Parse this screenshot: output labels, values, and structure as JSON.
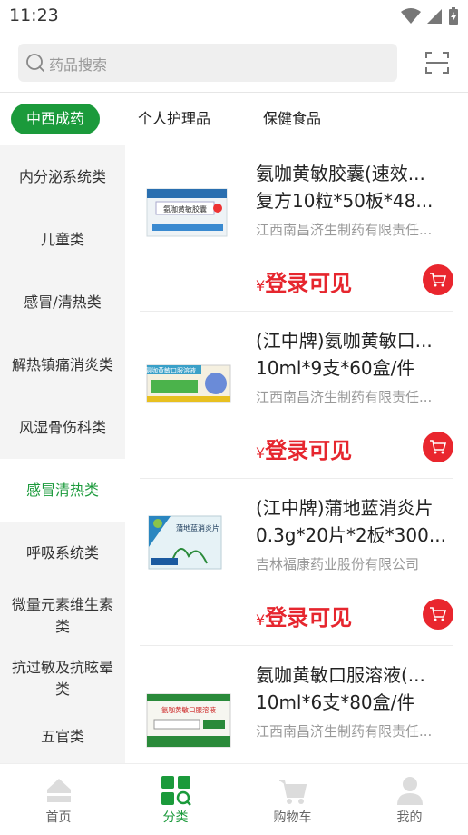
{
  "status_bar": {
    "time": "11:23"
  },
  "search": {
    "placeholder": "药品搜索"
  },
  "top_tabs": [
    {
      "label": "中西成药",
      "active": true
    },
    {
      "label": "个人护理品",
      "active": false
    },
    {
      "label": "保健食品",
      "active": false
    }
  ],
  "sidebar": {
    "items": [
      {
        "label": "内分泌系统类",
        "active": false
      },
      {
        "label": "儿童类",
        "active": false
      },
      {
        "label": "感冒/清热类",
        "active": false
      },
      {
        "label": "解热镇痛消炎类",
        "active": false
      },
      {
        "label": "风湿骨伤科类",
        "active": false
      },
      {
        "label": "感冒清热类",
        "active": true
      },
      {
        "label": "呼吸系统类",
        "active": false
      },
      {
        "label": "微量元素维生素类",
        "active": false
      },
      {
        "label": "抗过敏及抗眩晕类",
        "active": false
      },
      {
        "label": "五官类",
        "active": false
      }
    ]
  },
  "products": [
    {
      "title": "氨咖黄敏胶囊(速效...",
      "spec": "复方10粒*50板*48...",
      "maker": "江西南昌济生制药有限责任...",
      "price_symbol": "¥",
      "price_text": "登录可见",
      "pack_text": "氨咖黄敏胶囊"
    },
    {
      "title": "(江中牌)氨咖黄敏口...",
      "spec": "10ml*9支*60盒/件",
      "maker": "江西南昌济生制药有限责任...",
      "price_symbol": "¥",
      "price_text": "登录可见",
      "pack_text": "氨咖黄敏口服溶液"
    },
    {
      "title": "(江中牌)蒲地蓝消炎片",
      "spec": "0.3g*20片*2板*300...",
      "maker": "吉林福康药业股份有限公司",
      "price_symbol": "¥",
      "price_text": "登录可见",
      "pack_text": "蒲地蓝消炎片"
    },
    {
      "title": "氨咖黄敏口服溶液(...",
      "spec": "10ml*6支*80盒/件",
      "maker": "江西南昌济生制药有限责任...",
      "price_symbol": "¥",
      "price_text": "登录可见",
      "pack_text": "氨咖黄敏口服溶液"
    }
  ],
  "bottom_nav": [
    {
      "label": "首页",
      "icon": "home-icon",
      "active": false
    },
    {
      "label": "分类",
      "icon": "category-icon",
      "active": true
    },
    {
      "label": "购物车",
      "icon": "cart-icon",
      "active": false
    },
    {
      "label": "我的",
      "icon": "user-icon",
      "active": false
    }
  ],
  "colors": {
    "brand_green": "#1b9a3b",
    "price_red": "#e6262e"
  }
}
